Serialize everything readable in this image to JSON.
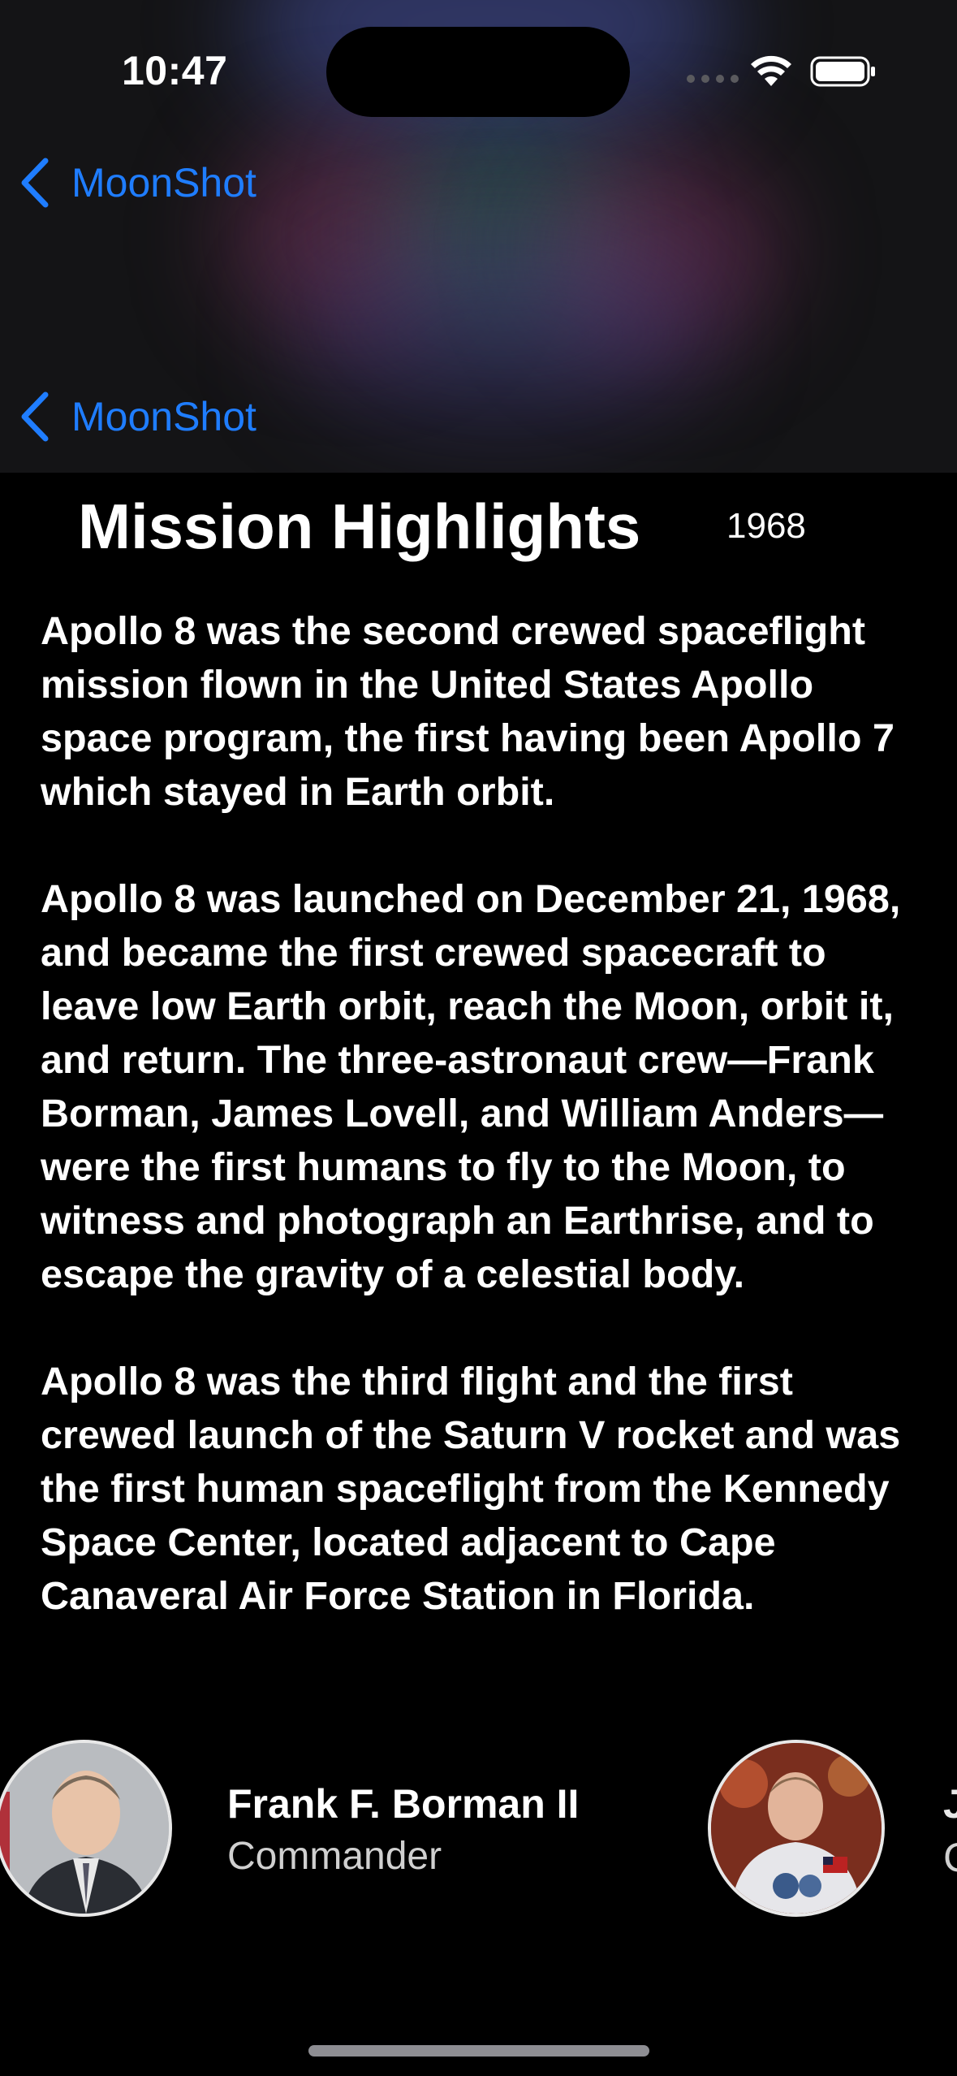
{
  "status_bar": {
    "time": "10:47"
  },
  "nav": {
    "back_label": "MoonShot",
    "back_label_secondary": "MoonShot",
    "accent_color": "#1f7dff"
  },
  "mission": {
    "title": "Mission Highlights",
    "year": "1968",
    "paragraphs": [
      "Apollo 8 was the second crewed spaceflight mission flown in the United States Apollo space program, the first having been Apollo 7 which stayed in Earth orbit.",
      "Apollo 8 was launched on December 21, 1968, and became the first crewed spacecraft to leave low Earth orbit, reach the Moon, orbit it, and return. The three-astronaut crew—Frank Borman, James Lovell, and William Anders—were the first humans to fly to the Moon, to witness and photograph an Earthrise, and to escape the gravity of a celestial body.",
      "Apollo 8 was the third flight and the first crewed launch of the Saturn V rocket and was the first human spaceflight from the Kennedy Space Center, located adjacent to Cape Canaveral Air Force Station in Florida."
    ]
  },
  "crew": [
    {
      "name": "Frank F. Borman II",
      "role": "Commander"
    },
    {
      "name_visible": "J",
      "role_visible": "C"
    }
  ],
  "icons": [
    "chevron-left-icon",
    "wifi-icon",
    "battery-icon"
  ]
}
